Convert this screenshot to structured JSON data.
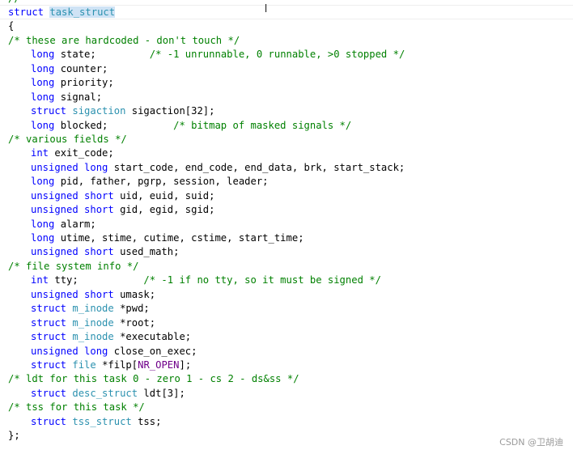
{
  "editor": {
    "top_comment": "// -----------------------------",
    "lines": {
      "l1_kw": "struct",
      "l1_name": "task_struct",
      "l2": "{",
      "l3": "/* these are hardcoded - don't touch */",
      "l4_kw": "long",
      "l4_id": " state;         ",
      "l4_cm": "/* -1 unrunnable, 0 runnable, >0 stopped */",
      "l5_kw": "long",
      "l5_id": " counter;",
      "l6_kw": "long",
      "l6_id": " priority;",
      "l7_kw": "long",
      "l7_id": " signal;",
      "l8_kw": "struct",
      "l8_ty": "sigaction",
      "l8_id": " sigaction[32];",
      "l9_kw": "long",
      "l9_id": " blocked;           ",
      "l9_cm": "/* bitmap of masked signals */",
      "l10": "/* various fields */",
      "l11_kw": "int",
      "l11_id": " exit_code;",
      "l12_kw": "unsigned long",
      "l12_id": " start_code, end_code, end_data, brk, start_stack;",
      "l13_kw": "long",
      "l13_id": " pid, father, pgrp, session, leader;",
      "l14_kw": "unsigned short",
      "l14_id": " uid, euid, suid;",
      "l15_kw": "unsigned short",
      "l15_id": " gid, egid, sgid;",
      "l16_kw": "long",
      "l16_id": " alarm;",
      "l17_kw": "long",
      "l17_id": " utime, stime, cutime, cstime, start_time;",
      "l18_kw": "unsigned short",
      "l18_id": " used_math;",
      "l19": "/* file system info */",
      "l20_kw": "int",
      "l20_id": " tty;           ",
      "l20_cm": "/* -1 if no tty, so it must be signed */",
      "l21_kw": "unsigned short",
      "l21_id": " umask;",
      "l22_kw": "struct",
      "l22_ty": "m_inode",
      "l22_id": " *pwd;",
      "l23_kw": "struct",
      "l23_ty": "m_inode",
      "l23_id": " *root;",
      "l24_kw": "struct",
      "l24_ty": "m_inode",
      "l24_id": " *executable;",
      "l25_kw": "unsigned long",
      "l25_id": " close_on_exec;",
      "l26_kw": "struct",
      "l26_ty": "file",
      "l26_id": " *filp[",
      "l26_mc": "NR_OPEN",
      "l26_end": "];",
      "l27": "/* ldt for this task 0 - zero 1 - cs 2 - ds&ss */",
      "l28_kw": "struct",
      "l28_ty": "desc_struct",
      "l28_id": " ldt[3];",
      "l29": "/* tss for this task */",
      "l30_kw": "struct",
      "l30_ty": "tss_struct",
      "l30_id": " tss;",
      "l31": "};"
    }
  },
  "cursor_icon": "text-cursor-icon",
  "cursor_glyph": "I",
  "watermark": "CSDN @卫胡迪",
  "colors": {
    "keyword": "#0000ff",
    "type": "#2b91af",
    "comment": "#008000",
    "macro": "#6f008a",
    "selection": "#cfe3f5"
  }
}
